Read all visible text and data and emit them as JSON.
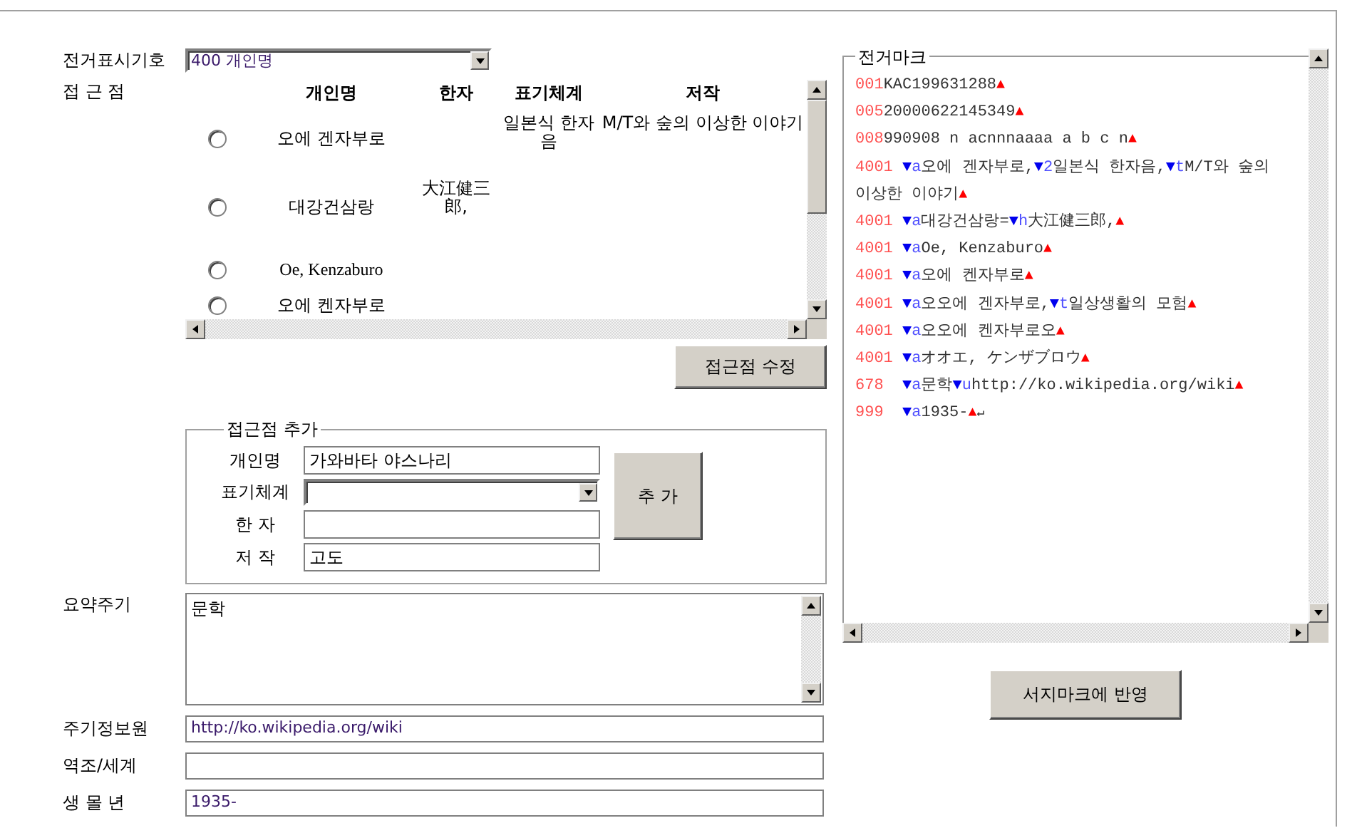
{
  "authority_code": {
    "label": "전거표시기호",
    "value": "400 개인명"
  },
  "access_points": {
    "label": "접 근 점",
    "columns": [
      "개인명",
      "한자",
      "표기체계",
      "저작"
    ],
    "rows": [
      {
        "selected": false,
        "name": "오에 겐자부로",
        "script": "일본식 한자음",
        "work": "M/T와 숲의 이상한 이야기"
      },
      {
        "selected": false,
        "name": "대강건삼랑",
        "hanja": "大江健三郎,"
      },
      {
        "selected": false,
        "name": "Oe, Kenzaburo"
      },
      {
        "selected": false,
        "name": "오에 켄자부로"
      }
    ],
    "edit_button": "접근점 수정"
  },
  "add_access_point": {
    "legend": "접근점 추가",
    "fields": [
      {
        "kind": "text",
        "label": "개인명",
        "value": "가와바타 야스나리"
      },
      {
        "kind": "select",
        "label": "표기체계"
      },
      {
        "kind": "text",
        "label": "한 자"
      },
      {
        "kind": "text",
        "label": "저 작",
        "value": "고도"
      }
    ],
    "add_button": "추 가"
  },
  "summary_note": {
    "label": "요약주기",
    "value": "문학"
  },
  "fields": [
    {
      "label": "주기정보원",
      "value": "http://ko.wikipedia.org/wiki"
    },
    {
      "label": "역조/세계"
    },
    {
      "label": "생 몰 년",
      "value": "1935-"
    }
  ],
  "marc": {
    "legend": "전거마크",
    "lines": [
      {
        "kind": "control",
        "tag": "001",
        "parts": [
          {
            "kind": "text",
            "text": "KAC199631288"
          },
          {
            "kind": "end",
            "text": "▲"
          }
        ]
      },
      {
        "kind": "control",
        "tag": "005",
        "parts": [
          {
            "kind": "text",
            "text": "20000622145349"
          },
          {
            "kind": "end",
            "text": "▲"
          }
        ]
      },
      {
        "kind": "control",
        "tag": "008",
        "parts": [
          {
            "kind": "text",
            "text": "990908 n acnnnaaaa a b c n"
          },
          {
            "kind": "end",
            "text": "▲"
          }
        ]
      },
      {
        "kind": "data",
        "tag": "4001",
        "parts": [
          {
            "kind": "sub",
            "text": "▼a"
          },
          {
            "kind": "text",
            "text": "오에 겐자부로,"
          },
          {
            "kind": "sub",
            "text": "▼2"
          },
          {
            "kind": "text",
            "text": "일본식 한자음,"
          },
          {
            "kind": "sub",
            "text": "▼t"
          },
          {
            "kind": "text",
            "text": "M/T와 숲의 이상한 이야기"
          },
          {
            "kind": "end",
            "text": "▲"
          }
        ]
      },
      {
        "kind": "data",
        "tag": "4001",
        "parts": [
          {
            "kind": "sub",
            "text": "▼a"
          },
          {
            "kind": "text",
            "text": "대강건삼랑="
          },
          {
            "kind": "sub",
            "text": "▼h"
          },
          {
            "kind": "text",
            "text": "大江健三郎,"
          },
          {
            "kind": "end",
            "text": "▲"
          }
        ]
      },
      {
        "kind": "data",
        "tag": "4001",
        "parts": [
          {
            "kind": "sub",
            "text": "▼a"
          },
          {
            "kind": "text",
            "text": "Oe, Kenzaburo"
          },
          {
            "kind": "end",
            "text": "▲"
          }
        ]
      },
      {
        "kind": "data",
        "tag": "4001",
        "parts": [
          {
            "kind": "sub",
            "text": "▼a"
          },
          {
            "kind": "text",
            "text": "오에 켄자부로"
          },
          {
            "kind": "end",
            "text": "▲"
          }
        ]
      },
      {
        "kind": "data",
        "tag": "4001",
        "parts": [
          {
            "kind": "sub",
            "text": "▼a"
          },
          {
            "kind": "text",
            "text": "오오에 겐자부로,"
          },
          {
            "kind": "sub",
            "text": "▼t"
          },
          {
            "kind": "text",
            "text": "일상생활의 모험"
          },
          {
            "kind": "end",
            "text": "▲"
          }
        ]
      },
      {
        "kind": "data",
        "tag": "4001",
        "parts": [
          {
            "kind": "sub",
            "text": "▼a"
          },
          {
            "kind": "text",
            "text": "오오에 켄자부로오"
          },
          {
            "kind": "end",
            "text": "▲"
          }
        ]
      },
      {
        "kind": "data",
        "tag": "4001",
        "parts": [
          {
            "kind": "sub",
            "text": "▼a"
          },
          {
            "kind": "text",
            "text": "オオエ, ケンザブロウ"
          },
          {
            "kind": "end",
            "text": "▲"
          }
        ]
      },
      {
        "kind": "data",
        "tag": "678",
        "parts": [
          {
            "kind": "sub",
            "text": "▼a"
          },
          {
            "kind": "text",
            "text": "문학"
          },
          {
            "kind": "sub",
            "text": "▼u"
          },
          {
            "kind": "text",
            "text": "http://ko.wikipedia.org/wiki"
          },
          {
            "kind": "end",
            "text": "▲"
          }
        ]
      },
      {
        "kind": "data",
        "tag": "999",
        "parts": [
          {
            "kind": "sub",
            "text": "▼a"
          },
          {
            "kind": "text",
            "text": "1935-"
          },
          {
            "kind": "end",
            "text": "▲"
          },
          {
            "kind": "newline",
            "text": "↵"
          }
        ]
      }
    ]
  },
  "apply_button": "서지마크에 반영"
}
